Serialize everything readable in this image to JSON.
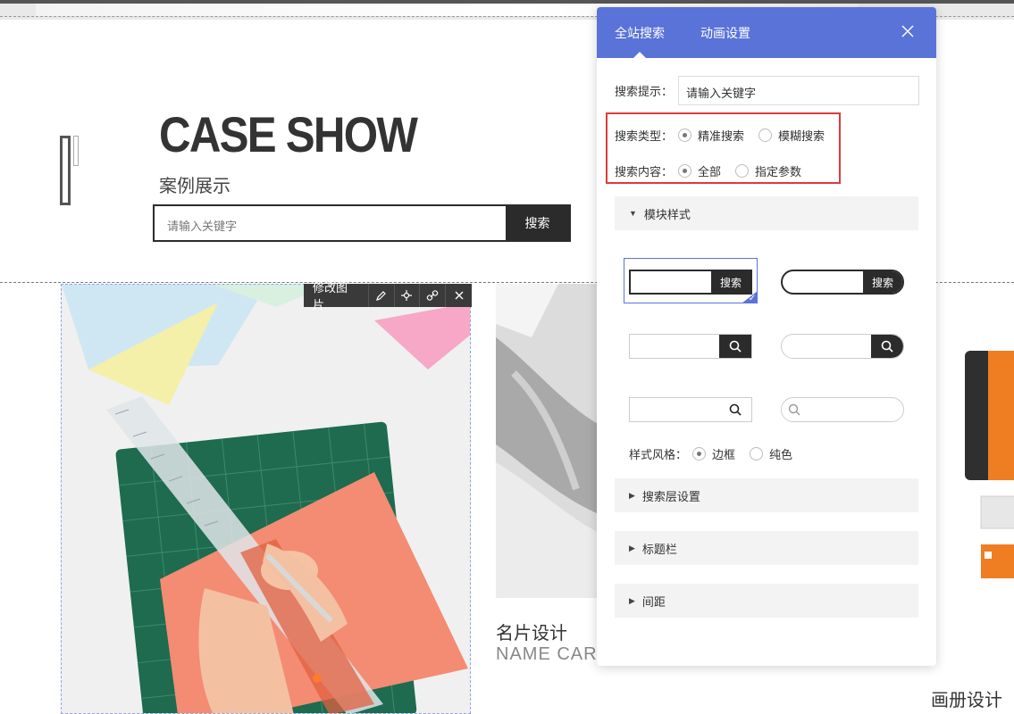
{
  "page": {
    "title": "CASE SHOW",
    "subtitle": "案例展示",
    "search_placeholder": "请输入关键字",
    "search_button": "搜索"
  },
  "gallery": [
    {
      "caption_cn": "",
      "caption_en": ""
    },
    {
      "caption_cn": "名片设计",
      "caption_en": "NAME CARD"
    },
    {
      "caption_cn": "画册设计",
      "caption_en": ""
    }
  ],
  "image_toolbar": {
    "edit_label": "修改图片",
    "tools": [
      "pencil-icon",
      "crop-icon",
      "link-icon",
      "close-icon"
    ]
  },
  "panel": {
    "tabs": [
      "全站搜索",
      "动画设置"
    ],
    "active_tab": "全站搜索",
    "hint_label": "搜索提示：",
    "hint_value": "请输入关键字",
    "type_label": "搜索类型：",
    "type_options": [
      "精准搜索",
      "模糊搜索"
    ],
    "type_selected": "精准搜索",
    "content_label": "搜索内容：",
    "content_options": [
      "全部",
      "指定参数"
    ],
    "content_selected": "全部",
    "sections": {
      "module_style": "模块样式",
      "search_layer": "搜索层设置",
      "title_bar": "标题栏",
      "spacing": "间距"
    },
    "style_button_label": "搜索",
    "style_label": "样式风格：",
    "style_options": [
      "边框",
      "纯色"
    ],
    "style_selected": "边框"
  },
  "colors": {
    "accent": "#5a73d8",
    "dark": "#2b2b2b",
    "highlight": "#e03a3a"
  }
}
